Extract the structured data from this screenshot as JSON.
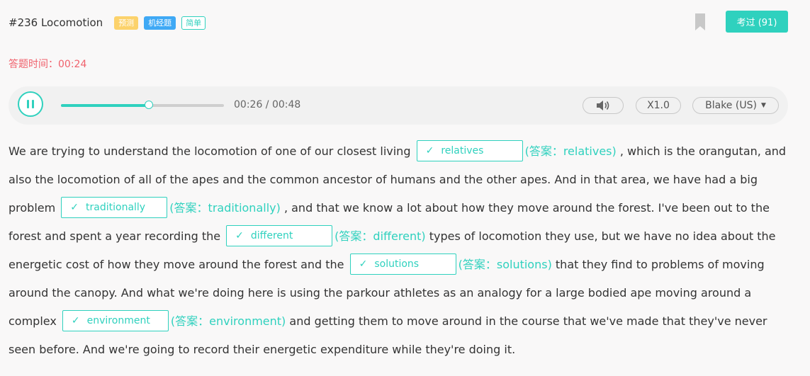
{
  "header": {
    "question_title": "#236 Locomotion",
    "tags": {
      "predict": "预测",
      "jijing": "机经题",
      "difficulty": "简单"
    },
    "pass_button": "考过 (91)"
  },
  "timer": {
    "label": "答题时间：00:24"
  },
  "player": {
    "progress": 0.54,
    "time_readout": "00:26 / 00:48",
    "speed": "X1.0",
    "voice": "Blake (US)",
    "icons": [
      "pause-icon",
      "volume-icon",
      "caret-down-icon"
    ]
  },
  "passage": {
    "seg0": "We are trying to understand the locomotion of one of our closest living",
    "blank1": "relatives",
    "ans1": "(答案：relatives)",
    "seg1": ", which is the orangutan, and also the locomotion of all of the apes and the common ancestor of humans and the other apes. And in that area, we have had a big problem",
    "blank2": "traditionally",
    "ans2": "(答案：traditionally)",
    "seg2": ", and that we know a lot about how they move around the forest. I've been out to the forest and spent a year recording the",
    "blank3": "different",
    "ans3": "(答案：different)",
    "seg3": "types of locomotion they use, but we have no idea about the energetic cost of how they move around the forest and the",
    "blank4": "solutions",
    "ans4": "(答案：solutions)",
    "seg4": "that they find to problems of moving around the canopy. And what we're doing here is using the parkour athletes as an analogy for a large bodied ape moving around a complex",
    "blank5": "environment",
    "ans5": "(答案：environment)",
    "seg5": "and getting them to move around in the course that we've made that they've never seen before. And we're going to record their energetic expenditure while they're doing it.",
    "check": "✓"
  },
  "colors": {
    "accent": "#2fd1be",
    "timer": "#f0616c",
    "predict": "#fcd26b",
    "jijing": "#3fa9f5"
  }
}
